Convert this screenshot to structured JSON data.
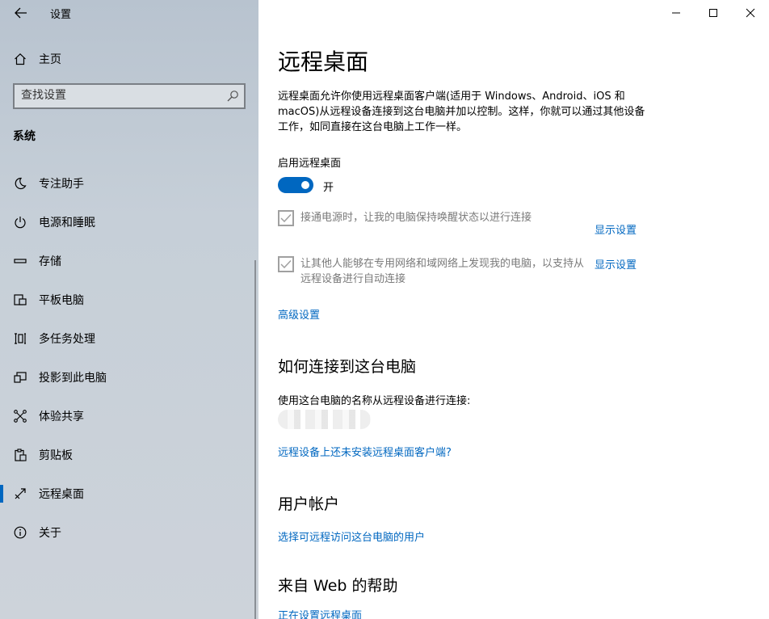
{
  "window": {
    "title": "设置"
  },
  "sidebar": {
    "home_label": "主页",
    "search_placeholder": "查找设置",
    "section_header": "系统",
    "items": [
      {
        "label": "专注助手",
        "icon": "moon-icon"
      },
      {
        "label": "电源和睡眠",
        "icon": "power-icon"
      },
      {
        "label": "存储",
        "icon": "storage-icon"
      },
      {
        "label": "平板电脑",
        "icon": "tablet-icon"
      },
      {
        "label": "多任务处理",
        "icon": "multitask-icon"
      },
      {
        "label": "投影到此电脑",
        "icon": "project-icon"
      },
      {
        "label": "体验共享",
        "icon": "share-icon"
      },
      {
        "label": "剪贴板",
        "icon": "clipboard-icon"
      },
      {
        "label": "远程桌面",
        "icon": "remote-desktop-icon",
        "selected": true
      },
      {
        "label": "关于",
        "icon": "info-icon"
      }
    ]
  },
  "main": {
    "title": "远程桌面",
    "description": "远程桌面允许你使用远程桌面客户端(适用于 Windows、Android、iOS 和 macOS)从远程设备连接到这台电脑并加以控制。这样，你就可以通过其他设备工作，如同直接在这台电脑上工作一样。",
    "enable_label": "启用远程桌面",
    "toggle_state": "开",
    "toggle_on": true,
    "checkbox1_text": "接通电源时，让我的电脑保持唤醒状态以进行连接",
    "checkbox1_link": "显示设置",
    "checkbox2_text": "让其他人能够在专用网络和域网络上发现我的电脑，以支持从远程设备进行自动连接",
    "checkbox2_link": "显示设置",
    "advanced_link": "高级设置",
    "connect_heading": "如何连接到这台电脑",
    "pc_name_label": "使用这台电脑的名称从远程设备进行连接:",
    "client_link": "远程设备上还未安装远程桌面客户端?",
    "accounts_heading": "用户帐户",
    "accounts_link": "选择可远程访问这台电脑的用户",
    "web_heading": "来自 Web 的帮助",
    "web_link": "正在设置远程桌面"
  },
  "colors": {
    "accent": "#0067c0",
    "sidebar_bg": "#c6cfd8"
  }
}
